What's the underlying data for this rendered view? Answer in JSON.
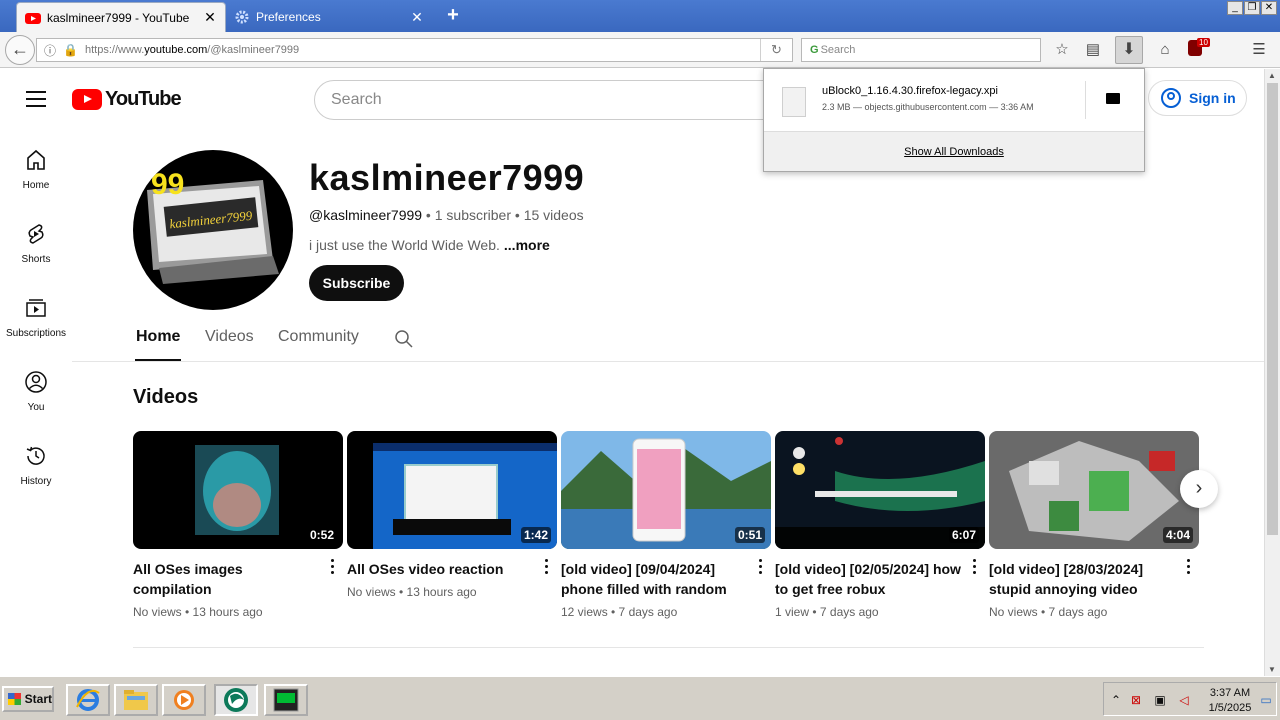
{
  "browser": {
    "tabs": [
      {
        "title": "kaslmineer7999 - YouTube",
        "active": true
      },
      {
        "title": "Preferences",
        "active": false
      }
    ],
    "new_tab": "+",
    "url_prefix": "https://www.",
    "url_domain": "youtube.com",
    "url_path": "/@kaslmineer7999",
    "search_placeholder": "Search",
    "window_controls": [
      "_",
      "❐",
      "✕"
    ]
  },
  "download_panel": {
    "filename": "uBlock0_1.16.4.30.firefox-legacy.xpi",
    "status": "2.3 MB — objects.githubusercontent.com — 3:36 AM",
    "show_all": "Show All Downloads"
  },
  "youtube": {
    "logo_text": "YouTube",
    "search_placeholder": "Search",
    "signin": "Sign in",
    "sidebar": [
      {
        "label": "Home",
        "icon": "home-icon"
      },
      {
        "label": "Shorts",
        "icon": "shorts-icon"
      },
      {
        "label": "Subscriptions",
        "icon": "subscriptions-icon"
      },
      {
        "label": "You",
        "icon": "you-icon"
      },
      {
        "label": "History",
        "icon": "history-icon"
      }
    ],
    "channel": {
      "name": "kaslmineer7999",
      "handle": "@kaslmineer7999",
      "subscribers": "1 subscriber",
      "videos_count": "15 videos",
      "separator": " • ",
      "description": "i just use the World Wide Web.",
      "more": "...more",
      "subscribe": "Subscribe",
      "avatar_text": "kaslmineer7999",
      "avatar_badge": "99"
    },
    "channel_tabs": [
      "Home",
      "Videos",
      "Community"
    ],
    "section_title": "Videos",
    "videos": [
      {
        "title": "All OSes images compilation",
        "meta": "No views • 13 hours ago",
        "duration": "0:52"
      },
      {
        "title": "All OSes video reaction",
        "meta": "No views • 13 hours ago",
        "duration": "1:42"
      },
      {
        "title": "[old video] [09/04/2024] phone filled with random",
        "meta": "12 views • 7 days ago",
        "duration": "0:51"
      },
      {
        "title": "[old video] [02/05/2024] how to get free robux",
        "meta": "1 view • 7 days ago",
        "duration": "6:07"
      },
      {
        "title": "[old video] [28/03/2024] stupid annoying video",
        "meta": "No views • 7 days ago",
        "duration": "4:04"
      }
    ]
  },
  "taskbar": {
    "start": "Start",
    "time": "3:37 AM",
    "date": "1/5/2025"
  }
}
